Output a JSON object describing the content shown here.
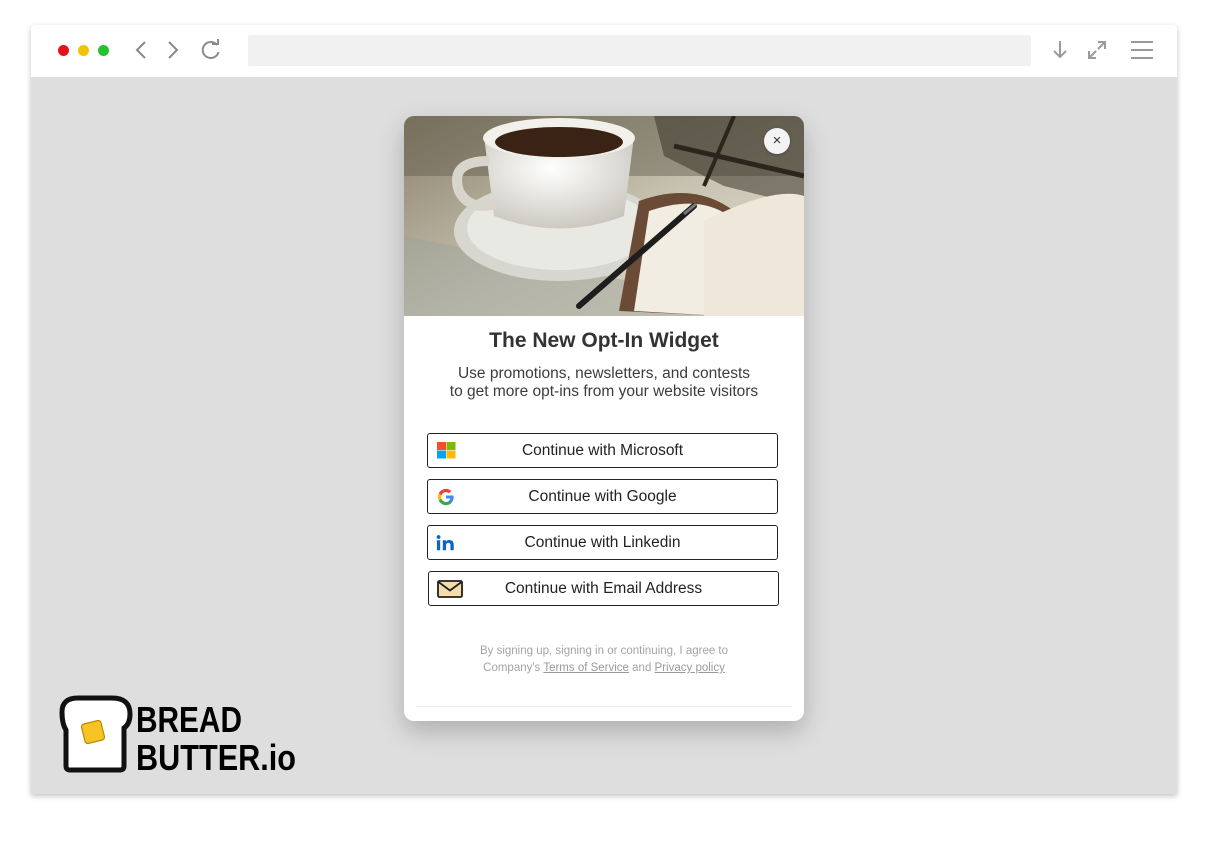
{
  "modal": {
    "title": "The New Opt-In Widget",
    "subtitle_line1": "Use promotions, newsletters, and contests",
    "subtitle_line2": "to get more opt-ins from your website visitors",
    "close_label": "×",
    "buttons": [
      {
        "label": "Continue with Microsoft",
        "icon": "microsoft-icon"
      },
      {
        "label": "Continue with Google",
        "icon": "google-icon"
      },
      {
        "label": "Continue with Linkedin",
        "icon": "linkedin-icon"
      },
      {
        "label": "Continue with Email Address",
        "icon": "envelope-icon"
      }
    ],
    "legal_prefix": "By signing up, signing in or continuing, I agree to",
    "legal_company": "Company's",
    "terms_link": "Terms of Service",
    "legal_and": "and",
    "privacy_link": "Privacy policy"
  },
  "logo": {
    "line1": "BREAD",
    "line2": "BUTTER.io"
  },
  "colors": {
    "traffic_red": "#e8101a",
    "traffic_yellow": "#f0c400",
    "traffic_green": "#22c232",
    "page_bg": "#dedede",
    "linkedin_blue": "#0a66c2",
    "butter_yellow": "#f7c325"
  },
  "icons": [
    "back-icon",
    "forward-icon",
    "reload-icon",
    "download-icon",
    "expand-icon",
    "menu-icon"
  ]
}
